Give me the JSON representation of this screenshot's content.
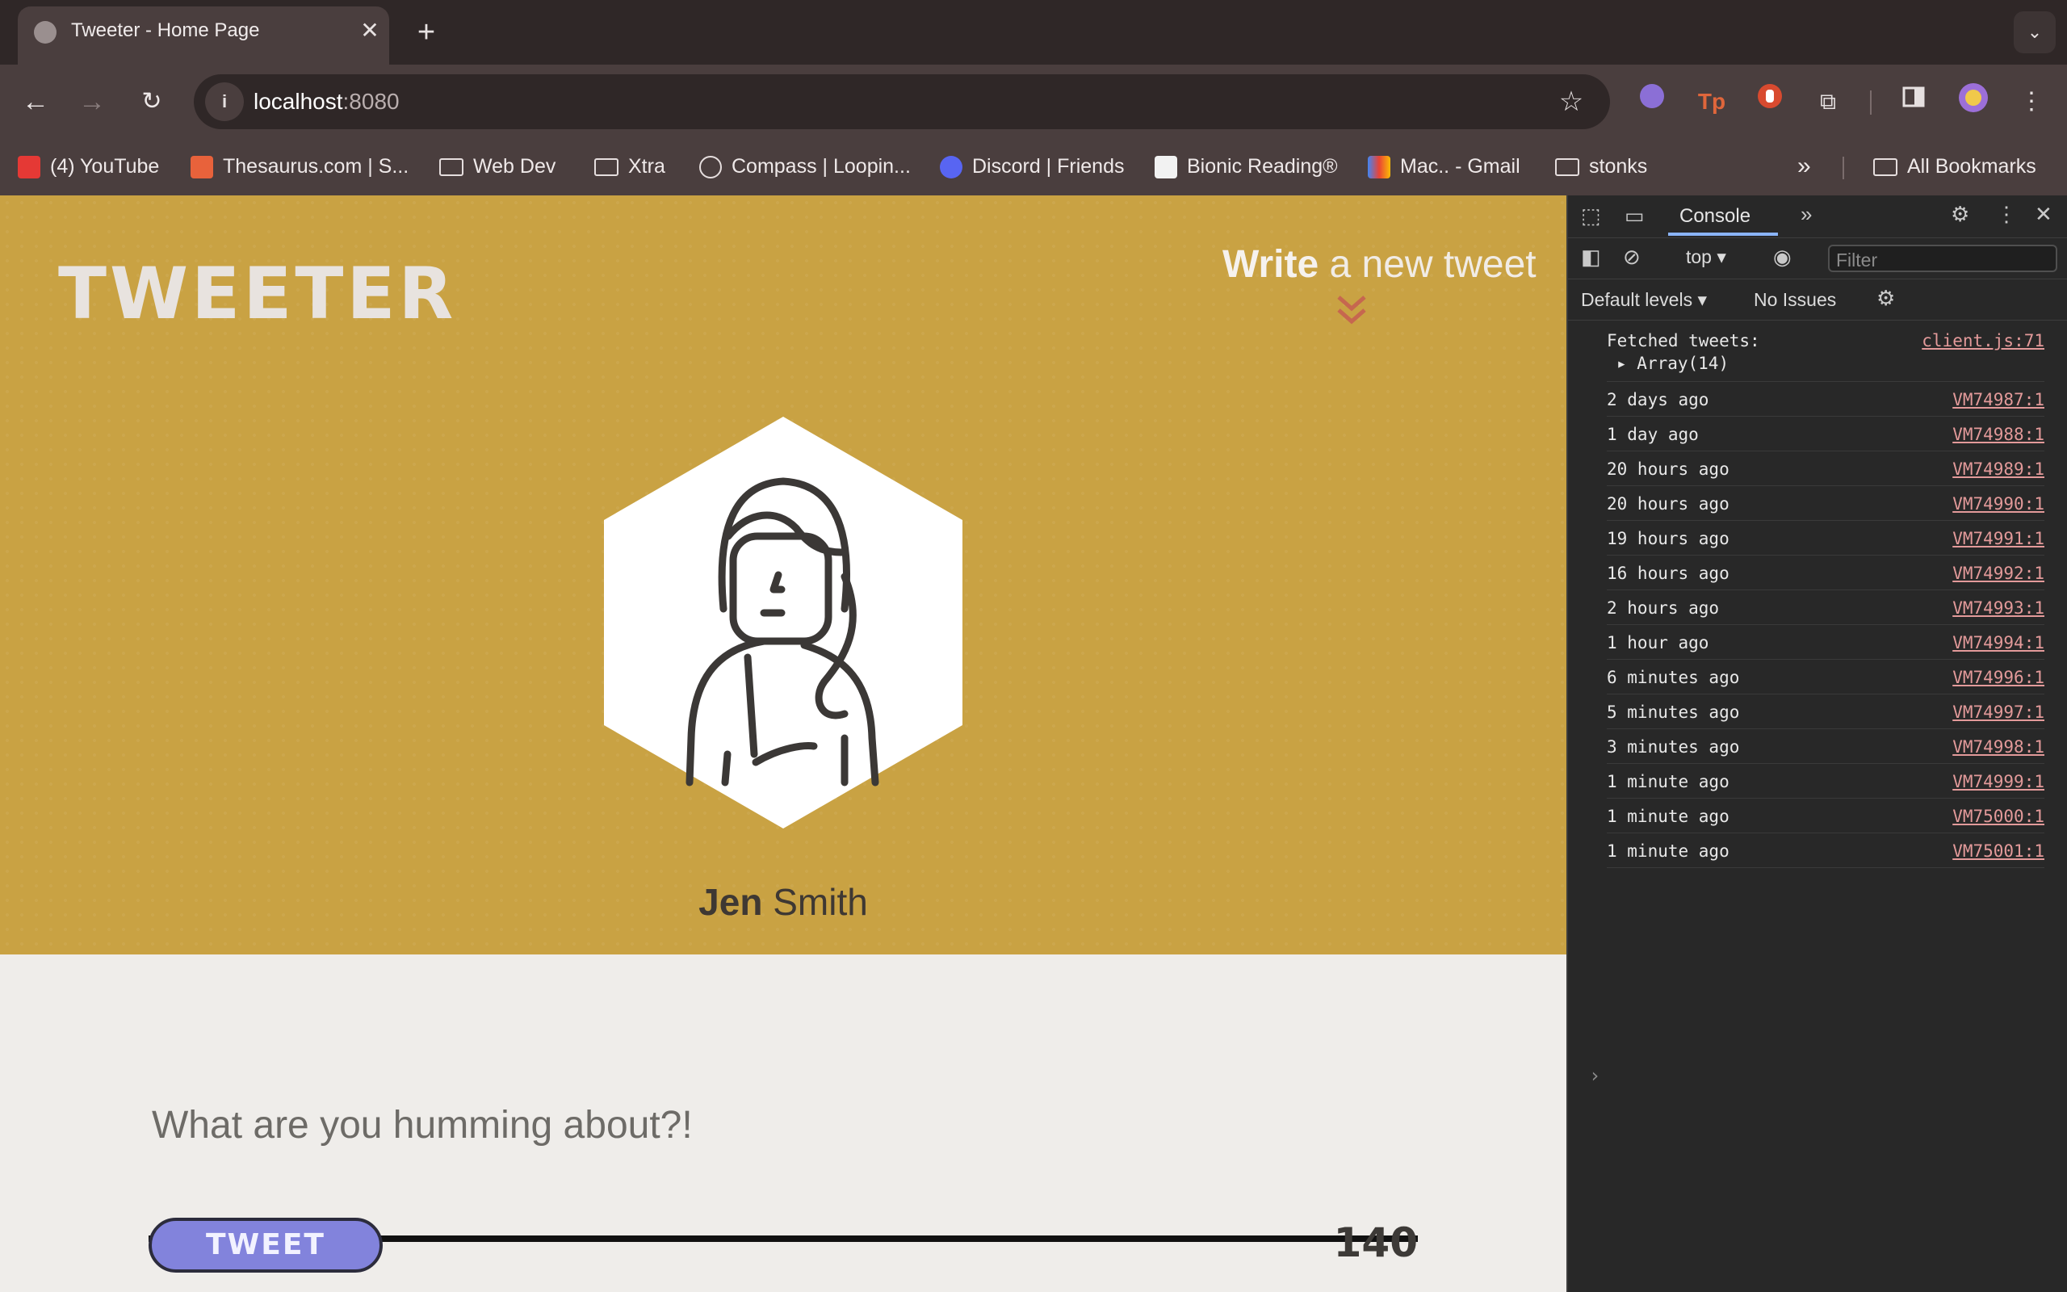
{
  "browser": {
    "tab_title": "Tweeter - Home Page",
    "url_host": "localhost",
    "url_port": ":8080",
    "bookmarks": [
      {
        "label": "(4) YouTube",
        "icon": "youtube-icon",
        "color": "#e53935"
      },
      {
        "label": "Thesaurus.com | S...",
        "icon": "thesaurus-icon",
        "color": "#e8623b"
      },
      {
        "label": "Web Dev",
        "icon": "folder-icon"
      },
      {
        "label": "Xtra",
        "icon": "folder-icon"
      },
      {
        "label": "Compass | Loopin...",
        "icon": "compass-icon"
      },
      {
        "label": "Discord | Friends",
        "icon": "discord-icon",
        "color": "#5865f2"
      },
      {
        "label": "Bionic Reading®",
        "icon": "bionic-reading-icon"
      },
      {
        "label": "Mac.. - Gmail",
        "icon": "gmail-icon",
        "color": "#ea4335"
      },
      {
        "label": "stonks",
        "icon": "folder-icon"
      }
    ],
    "all_bookmarks_label": "All Bookmarks"
  },
  "page": {
    "brand": "TWEETER",
    "write_bold": "Write",
    "write_rest": " a new tweet",
    "user_first": "Jen",
    "user_last": " Smith",
    "composer_placeholder": "What are you humming about?!",
    "tweet_button": "TWEET",
    "char_count": "140",
    "accent": "#c9a243",
    "button_color": "#8283dc"
  },
  "devtools": {
    "active_tab": "Console",
    "context": "top",
    "filter_placeholder": "Filter",
    "levels_label": "Default levels",
    "issues_label": "No Issues",
    "first_log": {
      "message": "Fetched tweets:",
      "sub": "Array(14)",
      "source": "client.js:71"
    },
    "logs": [
      {
        "message": "2 days ago",
        "source": "VM74987:1"
      },
      {
        "message": "1 day ago",
        "source": "VM74988:1"
      },
      {
        "message": "20 hours ago",
        "source": "VM74989:1"
      },
      {
        "message": "20 hours ago",
        "source": "VM74990:1"
      },
      {
        "message": "19 hours ago",
        "source": "VM74991:1"
      },
      {
        "message": "16 hours ago",
        "source": "VM74992:1"
      },
      {
        "message": "2 hours ago",
        "source": "VM74993:1"
      },
      {
        "message": "1 hour ago",
        "source": "VM74994:1"
      },
      {
        "message": "6 minutes ago",
        "source": "VM74996:1"
      },
      {
        "message": "5 minutes ago",
        "source": "VM74997:1"
      },
      {
        "message": "3 minutes ago",
        "source": "VM74998:1"
      },
      {
        "message": "1 minute ago",
        "source": "VM74999:1"
      },
      {
        "message": "1 minute ago",
        "source": "VM75000:1"
      },
      {
        "message": "1 minute ago",
        "source": "VM75001:1"
      }
    ]
  }
}
